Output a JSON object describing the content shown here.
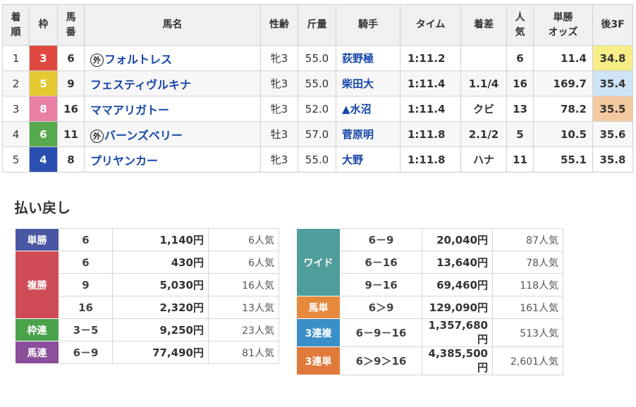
{
  "colors": {
    "waku_1": "#ffffff",
    "waku_2": "#222222",
    "waku_3": "#e0483f",
    "waku_4": "#2a4fb0",
    "waku_5": "#e5c832",
    "waku_6": "#56a94c",
    "waku_7": "#f08a2c",
    "waku_8": "#ea7fa6",
    "tansho": "#4b56a3",
    "fukusho": "#cf4b56",
    "wakuren": "#4aa24a",
    "umaren": "#8a4f9a",
    "wide": "#4f9e9b",
    "umatan": "#e7893b",
    "sanrenpuku": "#3b8fc9",
    "sanrentan": "#e07a3b"
  },
  "results": {
    "headers": [
      "着順",
      "枠",
      "馬番",
      "馬名",
      "性齢",
      "斤量",
      "騎手",
      "タイム",
      "着差",
      "人気",
      "単勝オッズ",
      "後3F"
    ],
    "headers_display": {
      "chakujun": [
        "着",
        "順"
      ],
      "waku": "枠",
      "umaban": [
        "馬",
        "番"
      ],
      "name": "馬名",
      "seirei": "性齢",
      "kinryo": "斤量",
      "jockey": "騎手",
      "time": "タイム",
      "margin": "着差",
      "pop": [
        "人",
        "気"
      ],
      "odds": [
        "単勝",
        "オッズ"
      ],
      "f3": "後3F"
    },
    "rows": [
      {
        "place": "1",
        "waku": "3",
        "umaban": "6",
        "mark": "外",
        "name": "フォルトレス",
        "sexage": "牝3",
        "weight": "55.0",
        "jockey": "荻野極",
        "time": "1:11.2",
        "margin": "",
        "pop": "6",
        "odds": "11.4",
        "f3": "34.8"
      },
      {
        "place": "2",
        "waku": "5",
        "umaban": "9",
        "mark": "",
        "name": "フェスティヴルキナ",
        "sexage": "牝3",
        "weight": "55.0",
        "jockey": "柴田大",
        "time": "1:11.4",
        "margin": "1.1/4",
        "pop": "16",
        "odds": "169.7",
        "f3": "35.4"
      },
      {
        "place": "3",
        "waku": "8",
        "umaban": "16",
        "mark": "",
        "name": "ママアリガトー",
        "sexage": "牝3",
        "weight": "52.0",
        "jockey": "▲水沼",
        "time": "1:11.4",
        "margin": "クビ",
        "pop": "13",
        "odds": "78.2",
        "f3": "35.5"
      },
      {
        "place": "4",
        "waku": "6",
        "umaban": "11",
        "mark": "外",
        "name": "バーンズベリー",
        "sexage": "牡3",
        "weight": "57.0",
        "jockey": "菅原明",
        "time": "1:11.8",
        "margin": "2.1/2",
        "pop": "5",
        "odds": "10.5",
        "f3": "35.6"
      },
      {
        "place": "5",
        "waku": "4",
        "umaban": "8",
        "mark": "",
        "name": "プリヤンカー",
        "sexage": "牝3",
        "weight": "55.0",
        "jockey": "大野",
        "time": "1:11.8",
        "margin": "ハナ",
        "pop": "11",
        "odds": "55.1",
        "f3": "35.8"
      }
    ]
  },
  "payout": {
    "title": "払い戻し",
    "left": [
      {
        "label": "単勝",
        "entries": [
          {
            "combo": "6",
            "yen": "1,140円",
            "pop": "6人気"
          }
        ]
      },
      {
        "label": "複勝",
        "entries": [
          {
            "combo": "6",
            "yen": "430円",
            "pop": "6人気"
          },
          {
            "combo": "9",
            "yen": "5,030円",
            "pop": "16人気"
          },
          {
            "combo": "16",
            "yen": "2,320円",
            "pop": "13人気"
          }
        ]
      },
      {
        "label": "枠連",
        "entries": [
          {
            "combo": "3－5",
            "yen": "9,250円",
            "pop": "23人気"
          }
        ]
      },
      {
        "label": "馬連",
        "entries": [
          {
            "combo": "6－9",
            "yen": "77,490円",
            "pop": "81人気"
          }
        ]
      }
    ],
    "right": [
      {
        "label": "ワイド",
        "entries": [
          {
            "combo": "6－9",
            "yen": "20,040円",
            "pop": "87人気"
          },
          {
            "combo": "6－16",
            "yen": "13,640円",
            "pop": "78人気"
          },
          {
            "combo": "9－16",
            "yen": "69,460円",
            "pop": "118人気"
          }
        ]
      },
      {
        "label": "馬単",
        "entries": [
          {
            "combo": "6＞9",
            "yen": "129,090円",
            "pop": "161人気"
          }
        ]
      },
      {
        "label": "3連複",
        "entries": [
          {
            "combo": "6－9－16",
            "yen": "1,357,680円",
            "pop": "513人気"
          }
        ]
      },
      {
        "label": "3連単",
        "entries": [
          {
            "combo": "6＞9＞16",
            "yen": "4,385,500円",
            "pop": "2,601人気"
          }
        ]
      }
    ]
  }
}
